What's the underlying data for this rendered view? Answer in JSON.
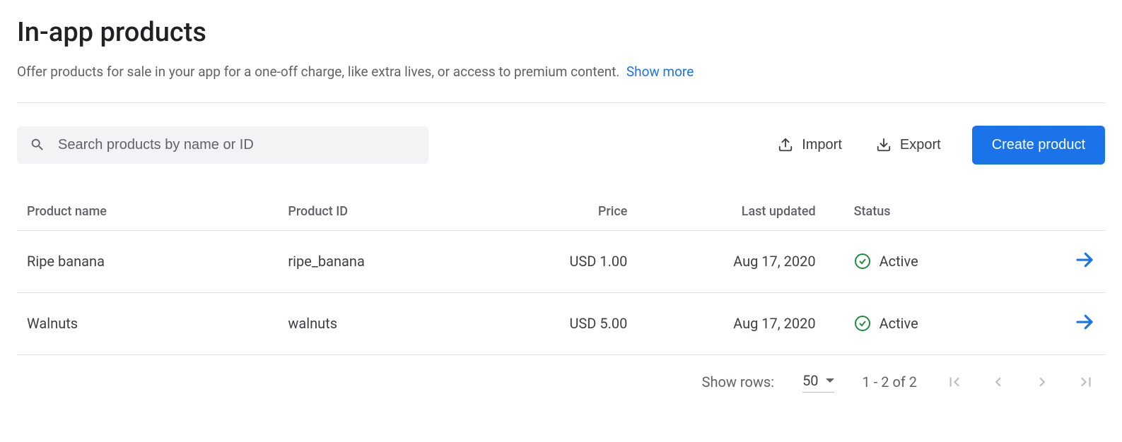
{
  "header": {
    "title": "In-app products",
    "subtitle": "Offer products for sale in your app for a one-off charge, like extra lives, or access to premium content.",
    "show_more": "Show more"
  },
  "toolbar": {
    "search_placeholder": "Search products by name or ID",
    "import_label": "Import",
    "export_label": "Export",
    "create_label": "Create product"
  },
  "table": {
    "columns": {
      "name": "Product name",
      "id": "Product ID",
      "price": "Price",
      "updated": "Last updated",
      "status": "Status"
    },
    "rows": [
      {
        "name": "Ripe banana",
        "id": "ripe_banana",
        "price": "USD 1.00",
        "updated": "Aug 17, 2020",
        "status": "Active"
      },
      {
        "name": "Walnuts",
        "id": "walnuts",
        "price": "USD 5.00",
        "updated": "Aug 17, 2020",
        "status": "Active"
      }
    ]
  },
  "footer": {
    "show_rows_label": "Show rows:",
    "rows_per_page": "50",
    "range": "1 - 2 of 2"
  }
}
